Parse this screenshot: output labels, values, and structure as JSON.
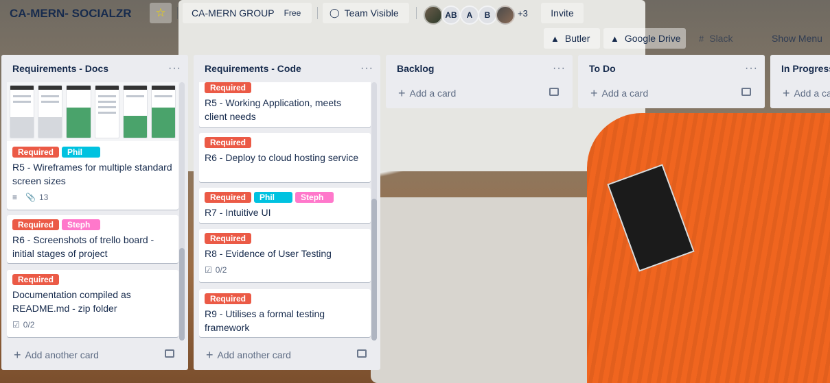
{
  "board": {
    "title": "CA-MERN- SOCIALZR",
    "star_icon": "star-icon",
    "team_name": "CA-MERN GROUP",
    "plan_badge": "Free",
    "visibility": "Team Visible",
    "members": [
      {
        "initials": "",
        "type": "photo"
      },
      {
        "initials": "AB",
        "type": "initials"
      },
      {
        "initials": "A",
        "type": "initials"
      },
      {
        "initials": "B",
        "type": "initials"
      },
      {
        "initials": "",
        "type": "photo"
      }
    ],
    "more_members": "+3",
    "invite_label": "Invite"
  },
  "menu_row": {
    "butler": "Butler",
    "google_drive": "Google Drive",
    "slack": "Slack",
    "show_menu": "Show Menu"
  },
  "lists": [
    {
      "title": "Requirements - Docs",
      "add_label": "Add another card",
      "cards": [
        {
          "labels": [
            {
              "text": "Required",
              "color": "#eb5a46"
            },
            {
              "text": "Phil",
              "color": "#00c2e0"
            }
          ],
          "title": "R5 - Wireframes for multiple standard screen sizes",
          "description": true,
          "attachments": "13"
        },
        {
          "labels": [
            {
              "text": "Required",
              "color": "#eb5a46"
            },
            {
              "text": "Steph",
              "color": "#ff78cb"
            }
          ],
          "title": "R6 - Screenshots of trello board - initial stages of project"
        },
        {
          "labels": [
            {
              "text": "Required",
              "color": "#eb5a46"
            }
          ],
          "title": "Documentation compiled as README.md - zip folder",
          "checklist": "0/2"
        }
      ]
    },
    {
      "title": "Requirements - Code",
      "add_label": "Add another card",
      "cards": [
        {
          "labels": [
            {
              "text": "Required",
              "color": "#eb5a46"
            }
          ],
          "title": "R5 - Working Application, meets client needs"
        },
        {
          "labels": [
            {
              "text": "Required",
              "color": "#eb5a46"
            }
          ],
          "title": "R6 - Deploy to cloud hosting service"
        },
        {
          "labels": [
            {
              "text": "Required",
              "color": "#eb5a46"
            },
            {
              "text": "Phil",
              "color": "#00c2e0"
            },
            {
              "text": "Steph",
              "color": "#ff78cb"
            }
          ],
          "title": "R7 - Intuitive UI"
        },
        {
          "labels": [
            {
              "text": "Required",
              "color": "#eb5a46"
            }
          ],
          "title": "R8 - Evidence of User Testing",
          "checklist": "0/2"
        },
        {
          "labels": [
            {
              "text": "Required",
              "color": "#eb5a46"
            }
          ],
          "title": "R9 - Utilises a formal testing framework"
        }
      ]
    },
    {
      "title": "Backlog",
      "add_label": "Add a card",
      "cards": []
    },
    {
      "title": "To Do",
      "add_label": "Add a card",
      "cards": []
    },
    {
      "title": "In Progress",
      "add_label": "Add a card",
      "cards": []
    }
  ]
}
